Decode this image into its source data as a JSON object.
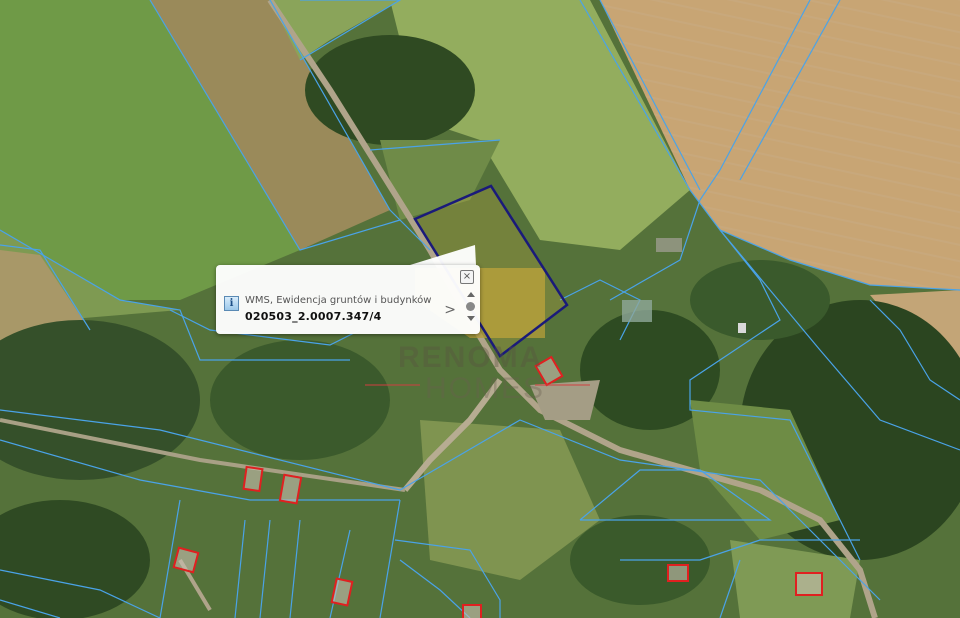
{
  "map": {
    "watermark_line1": "RENOMA",
    "watermark_line2": "HOMES"
  },
  "popup": {
    "close_icon": "close-x-icon",
    "info_icon_text": "i",
    "layer_name": "WMS, Ewidencja gruntów i budynków",
    "parcel_id": "020503_2.0007.347/4",
    "next_label": ">"
  },
  "colors": {
    "parcel_lines": "#4aa3e8",
    "selected_parcel": "#1a1a7a",
    "buildings": "#e02020"
  }
}
